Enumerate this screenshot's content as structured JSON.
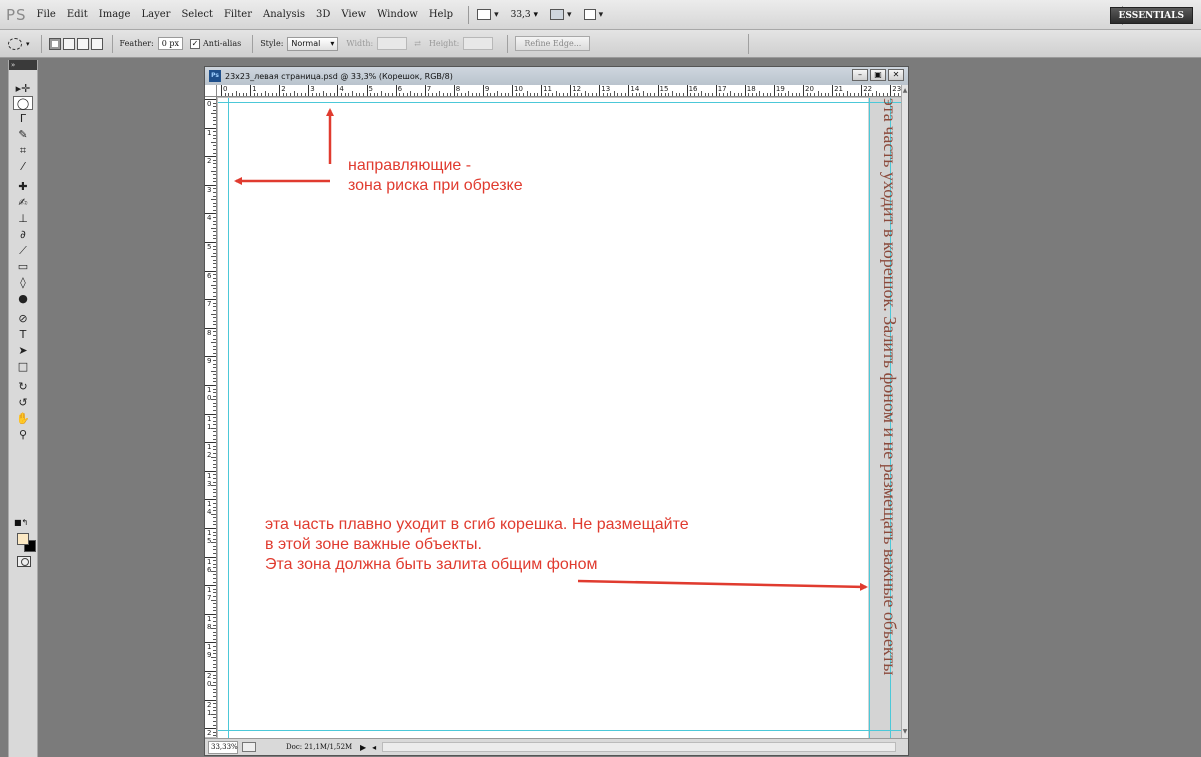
{
  "menubar": {
    "logo": "PS",
    "items": [
      "File",
      "Edit",
      "Image",
      "Layer",
      "Select",
      "Filter",
      "Analysis",
      "3D",
      "View",
      "Window",
      "Help"
    ],
    "zoom": "33,3",
    "workspace": "ESSENTIALS"
  },
  "options": {
    "feather_label": "Feather:",
    "feather_value": "0 px",
    "antialias_label": "Anti-alias",
    "style_label": "Style:",
    "style_value": "Normal",
    "width_label": "Width:",
    "height_label": "Height:",
    "refine_label": "Refine Edge..."
  },
  "document": {
    "title": "23x23_левая страница.psd @ 33,3% (Корешок, RGB/8)",
    "ruler_h": [
      "0",
      "1",
      "2",
      "3",
      "4",
      "5",
      "6",
      "7",
      "8",
      "9",
      "10",
      "11",
      "12",
      "13",
      "14",
      "15",
      "16",
      "17",
      "18",
      "19",
      "20",
      "21",
      "22",
      "23"
    ],
    "ruler_v": [
      "0",
      "1",
      "2",
      "3",
      "4",
      "5",
      "6",
      "7",
      "8",
      "9",
      "10",
      "11",
      "12",
      "13",
      "14",
      "15",
      "16",
      "17",
      "18",
      "19",
      "20",
      "21",
      "22"
    ],
    "status_zoom": "33,33%",
    "status_doc": "Doc: 21,1M/1,52M"
  },
  "annotations": {
    "guides_line1": "направляющие -",
    "guides_line2": "зона риска при обрезке",
    "fold_line1": "эта часть плавно уходит в сгиб корешка. Не размещайте",
    "fold_line2": " в этой зоне важные объекты.",
    "fold_line3": "Эта зона должна быть залита общим фоном",
    "spine_text": "эта часть уходит в корешок. Залить фоном и не размещать важные объекты"
  },
  "colors": {
    "annotation": "#e03b2f",
    "guide": "#4cc8d8",
    "spine": "#d4d4d4",
    "foreground": "#fce9c4",
    "background": "#000000"
  }
}
